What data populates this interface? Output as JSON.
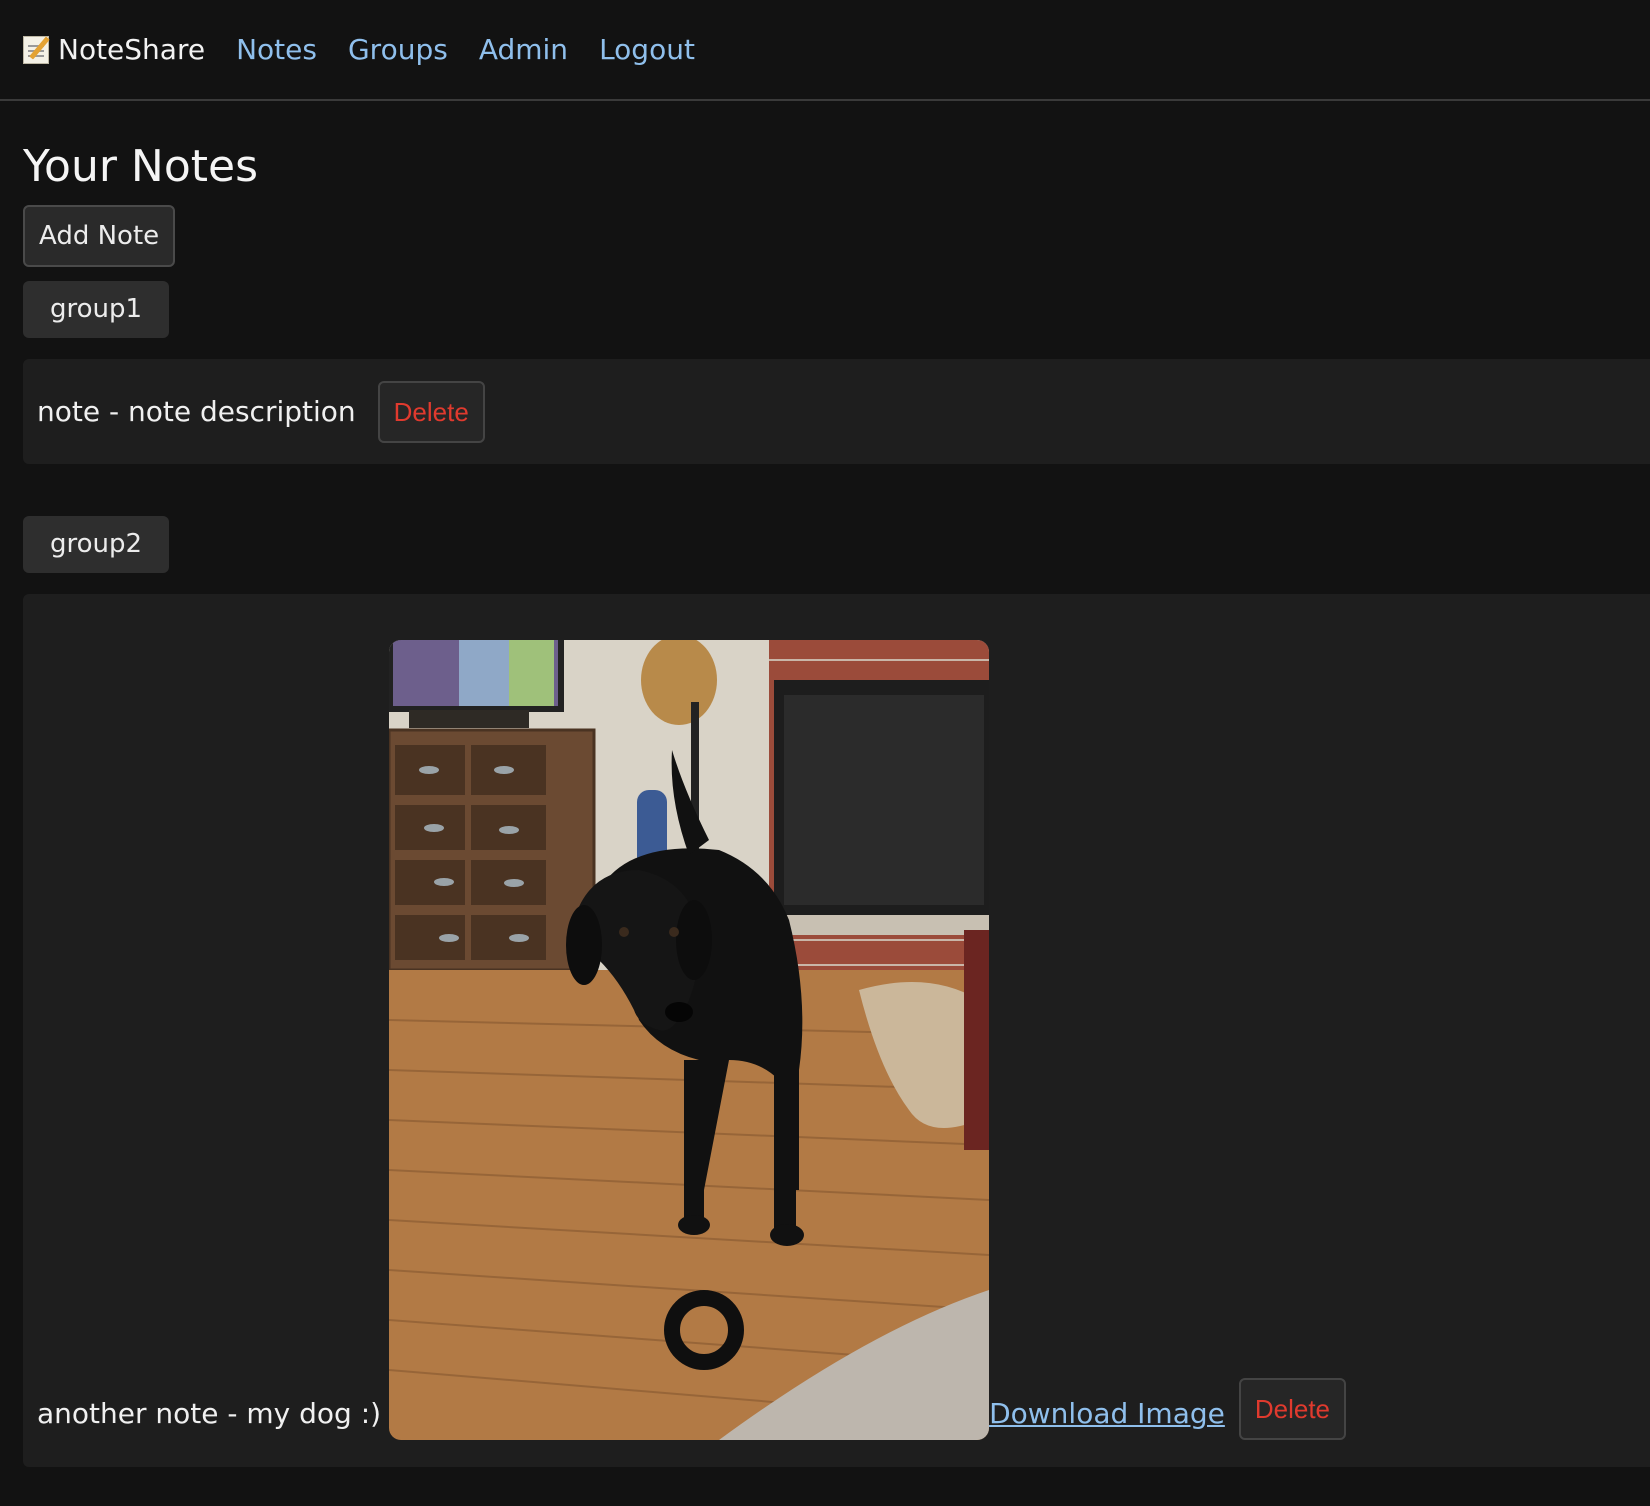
{
  "nav": {
    "brand": "NoteShare",
    "links": [
      "Notes",
      "Groups",
      "Admin",
      "Logout"
    ]
  },
  "page": {
    "title": "Your Notes",
    "add_note_label": "Add Note"
  },
  "groups": [
    {
      "name": "group1",
      "notes": [
        {
          "text": "note - note description",
          "delete_label": "Delete"
        }
      ]
    },
    {
      "name": "group2",
      "notes": [
        {
          "text": "another note - my dog :)",
          "download_label": "Download Image",
          "delete_label": "Delete"
        }
      ]
    }
  ],
  "colors": {
    "background": "#121212",
    "card": "#1e1e1e",
    "link": "#8fbfec",
    "danger": "#e03a2e"
  }
}
